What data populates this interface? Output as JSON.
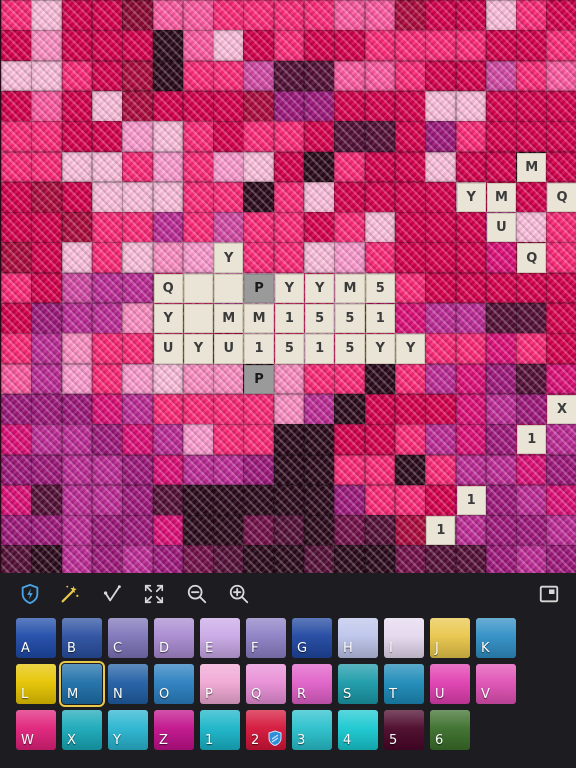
{
  "grid": {
    "cols": 19,
    "rows": 19,
    "colors": {
      "A": "#d9004e",
      "B": "#ff2a7a",
      "C": "#ff5aa2",
      "D": "#ff8fc4",
      "E": "#ffc0de",
      "F": "#e8337f",
      "G": "#b00b3f",
      "H": "#8e0a35",
      "I": "#ff9bd1",
      "J": "#d54aa6",
      "K": "#a0197d",
      "L": "#c02c98",
      "M": "#561038",
      "N": "#2c0a1c",
      "O": "#f2f2f2",
      "P": "#ffdff0",
      "Q": "#e0107a",
      "R": "#75104a"
    },
    "pattern": [
      "BEAAHCCBBBBCCGAAEBA",
      "ADAAANCEABAABBBBAAB",
      "EEBAGNBBJMMCCBAAJBC",
      "ACAEGAAAGKKAAAEEAAA",
      "BBAAIEBABBAMMAKBAAA",
      "BBEEBIBIEANBAAEAANA",
      "AGAEEEBBNBEAAAAEAAC",
      "AAGBBLBJBBABEAAAJEB",
      "GAEBEDIEBBEIBAAAQGB",
      "BAJLLBEIIEBDEBAAAAA",
      "AKLLDBBJEBBEQQLLMMA",
      "BLDBBBBAEBEBBIBBQBA",
      "CLIBIEDDNDBBNBLQKMQ",
      "KKKQLBBBBDLNAAAQLKQ",
      "QLLKQLIBBNNAABLQKQL",
      "KKLLKQLLKNNBBNBLLQK",
      "QMLLKMNNNNNKBBAQKLQ",
      "KKLKKQNNRMNRMGBLKKL",
      "MNLKLKRMNNMNNRMMKLK"
    ]
  },
  "labels": [
    {
      "col": 17,
      "row": 5,
      "text": "M"
    },
    {
      "col": 15,
      "row": 6,
      "text": "Y"
    },
    {
      "col": 16,
      "row": 6,
      "text": "M"
    },
    {
      "col": 18,
      "row": 6,
      "text": "Q"
    },
    {
      "col": 16,
      "row": 7,
      "text": "U"
    },
    {
      "col": 7,
      "row": 8,
      "text": "Y"
    },
    {
      "col": 17,
      "row": 8,
      "text": "Q"
    },
    {
      "col": 5,
      "row": 9,
      "text": "Q"
    },
    {
      "col": 6,
      "row": 9,
      "text": ""
    },
    {
      "col": 7,
      "row": 9,
      "text": ""
    },
    {
      "col": 8,
      "row": 9,
      "text": "P",
      "selected": true
    },
    {
      "col": 9,
      "row": 9,
      "text": "Y"
    },
    {
      "col": 10,
      "row": 9,
      "text": "Y"
    },
    {
      "col": 11,
      "row": 9,
      "text": "M"
    },
    {
      "col": 12,
      "row": 9,
      "text": "5"
    },
    {
      "col": 5,
      "row": 10,
      "text": "Y"
    },
    {
      "col": 6,
      "row": 10,
      "text": ""
    },
    {
      "col": 7,
      "row": 10,
      "text": "M"
    },
    {
      "col": 8,
      "row": 10,
      "text": "M"
    },
    {
      "col": 9,
      "row": 10,
      "text": "1"
    },
    {
      "col": 10,
      "row": 10,
      "text": "5"
    },
    {
      "col": 11,
      "row": 10,
      "text": "5"
    },
    {
      "col": 12,
      "row": 10,
      "text": "1"
    },
    {
      "col": 5,
      "row": 11,
      "text": "U"
    },
    {
      "col": 6,
      "row": 11,
      "text": "Y"
    },
    {
      "col": 7,
      "row": 11,
      "text": "U"
    },
    {
      "col": 8,
      "row": 11,
      "text": "1"
    },
    {
      "col": 9,
      "row": 11,
      "text": "5"
    },
    {
      "col": 10,
      "row": 11,
      "text": "1"
    },
    {
      "col": 11,
      "row": 11,
      "text": "5"
    },
    {
      "col": 12,
      "row": 11,
      "text": "Y"
    },
    {
      "col": 13,
      "row": 11,
      "text": "Y"
    },
    {
      "col": 8,
      "row": 12,
      "text": "P",
      "selected": true
    },
    {
      "col": 18,
      "row": 13,
      "text": "X"
    },
    {
      "col": 17,
      "row": 14,
      "text": "1"
    },
    {
      "col": 15,
      "row": 16,
      "text": "1"
    },
    {
      "col": 14,
      "row": 17,
      "text": "1"
    }
  ],
  "toolbar": {
    "tools": [
      {
        "name": "shield-bolt-icon",
        "color": "#4aa3e8"
      },
      {
        "name": "magic-wand-icon",
        "color": "#e8c94a"
      },
      {
        "name": "needle-icon",
        "color": "#d8d8d8"
      },
      {
        "name": "fit-screen-icon",
        "color": "#d8d8d8"
      },
      {
        "name": "zoom-out-icon",
        "color": "#d8d8d8"
      },
      {
        "name": "zoom-in-icon",
        "color": "#d8d8d8"
      },
      {
        "name": "minimap-icon",
        "color": "#d8d8d8"
      }
    ]
  },
  "palette": {
    "active": "M",
    "swatches": [
      {
        "label": "A",
        "color": "#1e4aa8"
      },
      {
        "label": "B",
        "color": "#2a4fa0"
      },
      {
        "label": "C",
        "color": "#7d74b8"
      },
      {
        "label": "D",
        "color": "#a88ad0"
      },
      {
        "label": "E",
        "color": "#c9a8e6"
      },
      {
        "label": "F",
        "color": "#8c7fc4"
      },
      {
        "label": "G",
        "color": "#1f46a0"
      },
      {
        "label": "H",
        "color": "#bcc4ea"
      },
      {
        "label": "I",
        "color": "#e4d8ee"
      },
      {
        "label": "J",
        "color": "#e8c64a"
      },
      {
        "label": "K",
        "color": "#2f8ec4"
      },
      {
        "label": "L",
        "color": "#e6c400"
      },
      {
        "label": "M",
        "color": "#1d6fa8"
      },
      {
        "label": "N",
        "color": "#205ea4"
      },
      {
        "label": "O",
        "color": "#2a7fc0"
      },
      {
        "label": "P",
        "color": "#f0a8d4"
      },
      {
        "label": "Q",
        "color": "#e88ed6"
      },
      {
        "label": "R",
        "color": "#e060c8"
      },
      {
        "label": "S",
        "color": "#1a9aa8"
      },
      {
        "label": "T",
        "color": "#1c8ab8"
      },
      {
        "label": "U",
        "color": "#e03eb0"
      },
      {
        "label": "V",
        "color": "#e050b4"
      },
      {
        "label": "W",
        "color": "#e0207a"
      },
      {
        "label": "X",
        "color": "#18a8b8"
      },
      {
        "label": "Y",
        "color": "#28b4d0"
      },
      {
        "label": "Z",
        "color": "#c0108a"
      },
      {
        "label": "1",
        "color": "#18b4c8"
      },
      {
        "label": "2",
        "color": "#d41438",
        "badge": "shield-badge-icon"
      },
      {
        "label": "3",
        "color": "#28c0cc"
      },
      {
        "label": "4",
        "color": "#18c8d0"
      },
      {
        "label": "5",
        "color": "#4a0628"
      },
      {
        "label": "6",
        "color": "#3a6e2a"
      }
    ]
  }
}
